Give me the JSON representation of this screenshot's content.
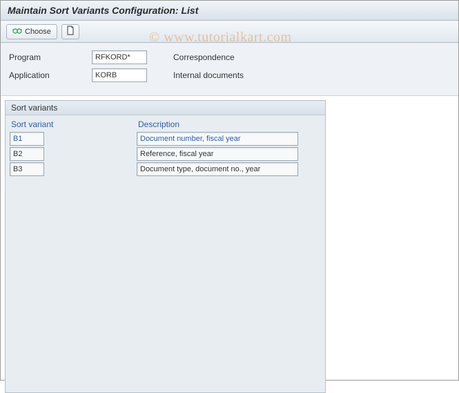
{
  "window": {
    "title": "Maintain Sort Variants Configuration: List"
  },
  "toolbar": {
    "choose_label": "Choose"
  },
  "header": {
    "program_label": "Program",
    "program_value": "RFKORD*",
    "program_desc": "Correspondence",
    "application_label": "Application",
    "application_value": "KORB",
    "application_desc": "Internal documents"
  },
  "panel": {
    "group_title": "Sort variants",
    "col_variant": "Sort variant",
    "col_description": "Description",
    "rows": [
      {
        "variant": "B1",
        "description": "Document number, fiscal year",
        "selected": true
      },
      {
        "variant": "B2",
        "description": "Reference, fiscal year",
        "selected": false
      },
      {
        "variant": "B3",
        "description": "Document type, document no., year",
        "selected": false
      }
    ]
  },
  "watermark": "© www.tutorialkart.com"
}
